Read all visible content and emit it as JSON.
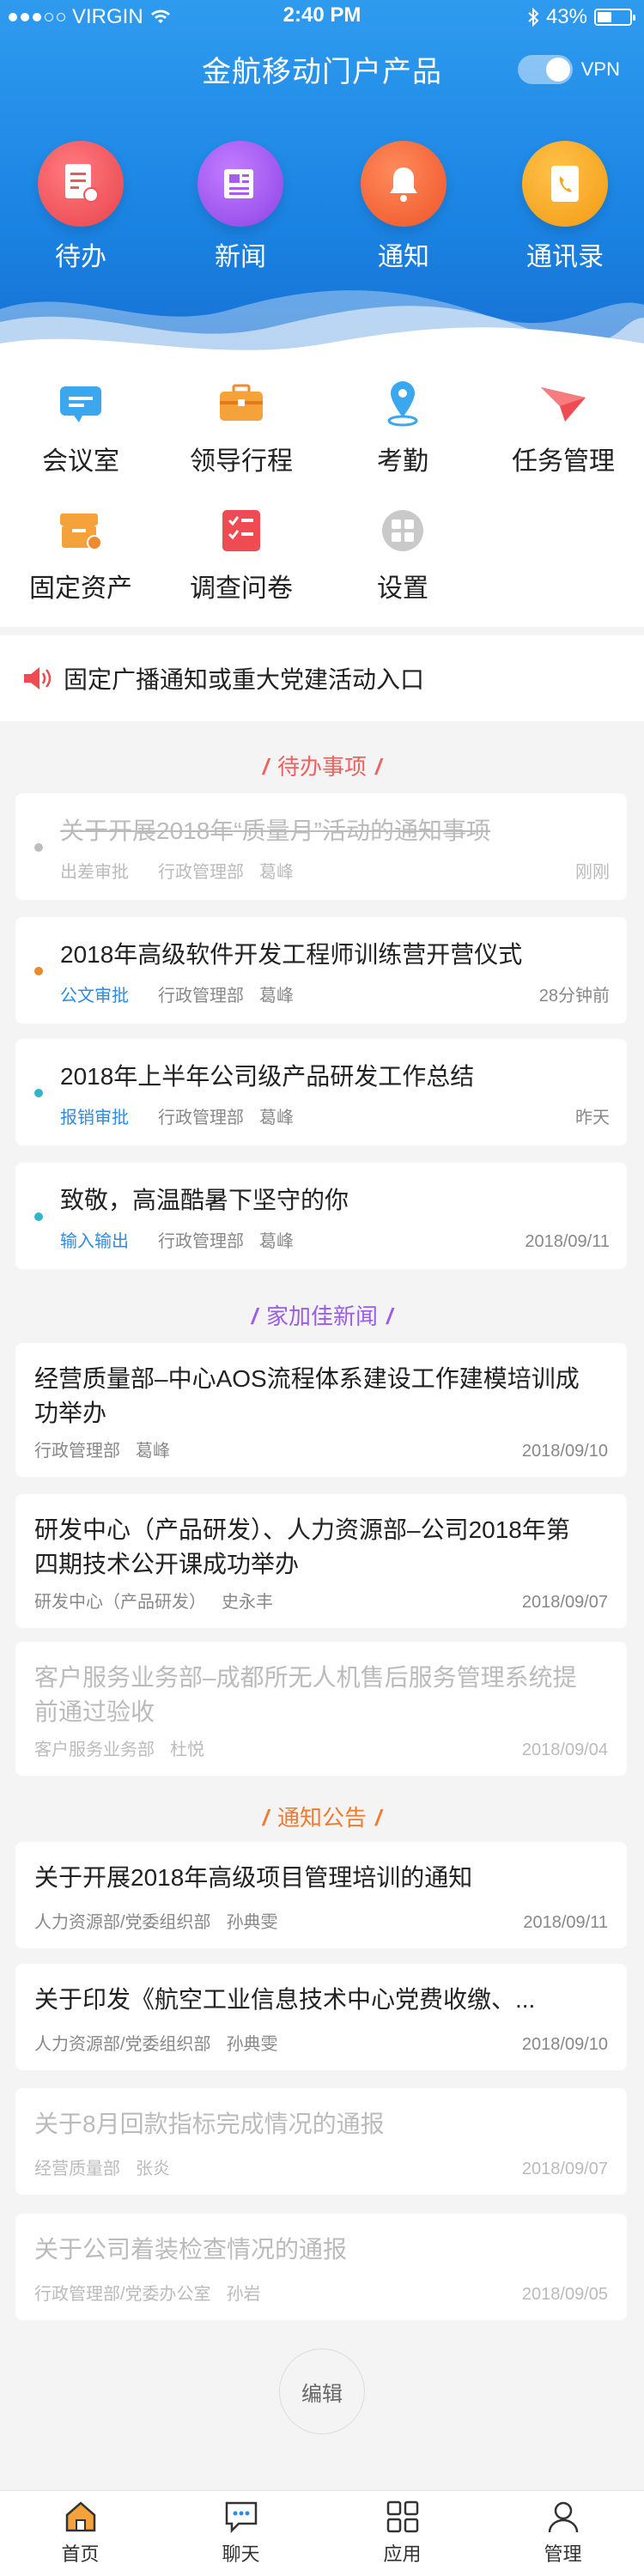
{
  "status": {
    "carrier": "VIRGIN",
    "time": "2:40 PM",
    "battery": "43%"
  },
  "header": {
    "title": "金航移动门户产品",
    "vpn_label": "VPN"
  },
  "top_nav": [
    {
      "label": "待办",
      "icon": "todo-doc-icon",
      "color": "#f2545b"
    },
    {
      "label": "新闻",
      "icon": "news-icon",
      "color": "#a65cf0"
    },
    {
      "label": "通知",
      "icon": "bell-icon",
      "color": "#f5663a"
    },
    {
      "label": "通讯录",
      "icon": "contacts-icon",
      "color": "#f5a623"
    }
  ],
  "grid": [
    {
      "label": "会议室",
      "icon": "meeting-room-icon"
    },
    {
      "label": "领导行程",
      "icon": "briefcase-icon"
    },
    {
      "label": "考勤",
      "icon": "location-pin-icon"
    },
    {
      "label": "任务管理",
      "icon": "paper-plane-icon"
    },
    {
      "label": "固定资产",
      "icon": "asset-box-icon"
    },
    {
      "label": "调查问卷",
      "icon": "survey-checklist-icon"
    },
    {
      "label": "设置",
      "icon": "settings-grid-icon"
    }
  ],
  "broadcast": {
    "text": "固定广播通知或重大党建活动入口"
  },
  "sections": {
    "todo": "待办事项",
    "news": "家加佳新闻",
    "notice": "通知公告"
  },
  "todos": [
    {
      "title": "关于开展2018年“质量月”活动的通知事项",
      "tag": "出差审批",
      "dept": "行政管理部",
      "person": "葛峰",
      "time": "刚刚",
      "dot": "#bdbdbd",
      "tag_color": "#bbbbbb"
    },
    {
      "title": "2018年高级软件开发工程师训练营开营仪式",
      "tag": "公文审批",
      "dept": "行政管理部",
      "person": "葛峰",
      "time": "28分钟前",
      "dot": "#e8892b",
      "tag_color": "#2f8be0"
    },
    {
      "title": "2018年上半年公司级产品研发工作总结",
      "tag": "报销审批",
      "dept": "行政管理部",
      "person": "葛峰",
      "time": "昨天",
      "dot": "#2fb7c8",
      "tag_color": "#2f8be0"
    },
    {
      "title": "致敬，高温酷暑下坚守的你",
      "tag": "输入输出",
      "dept": "行政管理部",
      "person": "葛峰",
      "time": "2018/09/11",
      "dot": "#2fb7c8",
      "tag_color": "#2f8be0"
    }
  ],
  "news": [
    {
      "title": "经营质量部–中心AOS流程体系建设工作建模培训成功举办",
      "dept": "行政管理部",
      "person": "葛峰",
      "time": "2018/09/10"
    },
    {
      "title": "研发中心（产品研发）、人力资源部–公司2018年第四期技术公开课成功举办",
      "dept": "研发中心（产品研发）",
      "person": "史永丰",
      "time": "2018/09/07"
    },
    {
      "title": "客户服务业务部–成都所无人机售后服务管理系统提前通过验收",
      "dept": "客户服务业务部",
      "person": "杜悦",
      "time": "2018/09/04"
    }
  ],
  "notices": [
    {
      "title": "关于开展2018年高级项目管理培训的通知",
      "dept": "人力资源部/党委组织部",
      "person": "孙典雯",
      "time": "2018/09/11"
    },
    {
      "title": "关于印发《航空工业信息技术中心党费收缴、...",
      "dept": "人力资源部/党委组织部",
      "person": "孙典雯",
      "time": "2018/09/10"
    },
    {
      "title": "关于8月回款指标完成情况的通报",
      "dept": "经营质量部",
      "person": "张炎",
      "time": "2018/09/07"
    },
    {
      "title": "关于公司着装检查情况的通报",
      "dept": "行政管理部/党委办公室",
      "person": "孙岩",
      "time": "2018/09/05"
    }
  ],
  "edit_label": "编辑",
  "tabs": [
    {
      "label": "首页",
      "icon": "home-icon"
    },
    {
      "label": "聊天",
      "icon": "chat-icon"
    },
    {
      "label": "应用",
      "icon": "apps-grid-icon"
    },
    {
      "label": "管理",
      "icon": "user-icon"
    }
  ]
}
